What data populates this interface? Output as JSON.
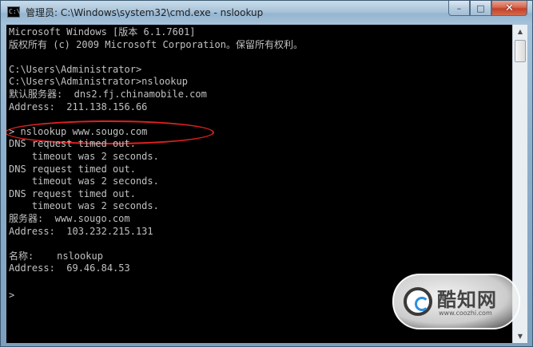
{
  "window": {
    "title": "管理员: C:\\Windows\\system32\\cmd.exe - nslookup",
    "icon": "cmd-icon",
    "buttons": {
      "minimize": "–",
      "maximize": "□",
      "close": "✕"
    }
  },
  "console": {
    "lines": [
      "Microsoft Windows [版本 6.1.7601]",
      "版权所有 (c) 2009 Microsoft Corporation。保留所有权利。",
      "",
      "C:\\Users\\Administrator>",
      "C:\\Users\\Administrator>nslookup",
      "默认服务器:  dns2.fj.chinamobile.com",
      "Address:  211.138.156.66",
      "",
      "> nslookup www.sougo.com",
      "DNS request timed out.",
      "    timeout was 2 seconds.",
      "DNS request timed out.",
      "    timeout was 2 seconds.",
      "DNS request timed out.",
      "    timeout was 2 seconds.",
      "服务器:  www.sougo.com",
      "Address:  103.232.215.131",
      "",
      "名称:    nslookup",
      "Address:  69.46.84.53"
    ],
    "prompt": ">"
  },
  "scrollbar": {
    "up_arrow": "▲",
    "down_arrow": "▼"
  },
  "watermark": {
    "name": "酷知网",
    "url": "www.coozhi.com"
  },
  "colors": {
    "console_bg": "#000000",
    "console_fg": "#c0c0c0",
    "highlight": "#e02020"
  }
}
